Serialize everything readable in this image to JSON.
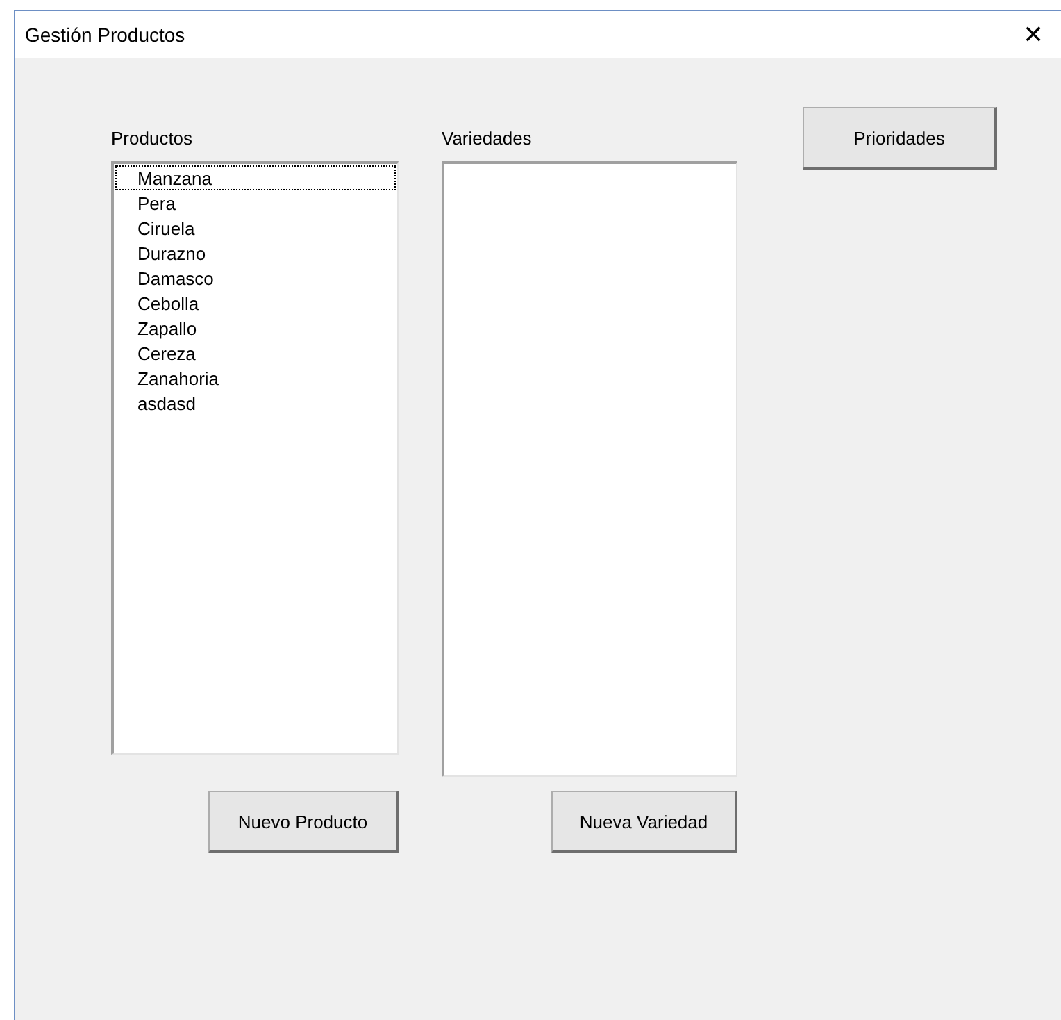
{
  "window": {
    "title": "Gestión Productos",
    "close": "✕"
  },
  "productos": {
    "label": "Productos",
    "items": [
      {
        "text": "Manzana",
        "focused": true
      },
      {
        "text": "Pera",
        "focused": false
      },
      {
        "text": "Ciruela",
        "focused": false
      },
      {
        "text": "Durazno",
        "focused": false
      },
      {
        "text": "Damasco",
        "focused": false
      },
      {
        "text": "Cebolla",
        "focused": false
      },
      {
        "text": "Zapallo",
        "focused": false
      },
      {
        "text": "Cereza",
        "focused": false
      },
      {
        "text": "Zanahoria",
        "focused": false
      },
      {
        "text": "asdasd",
        "focused": false
      }
    ],
    "button": "Nuevo Producto"
  },
  "variedades": {
    "label": "Variedades",
    "button": "Nueva Variedad"
  },
  "prioridades_button": "Prioridades"
}
